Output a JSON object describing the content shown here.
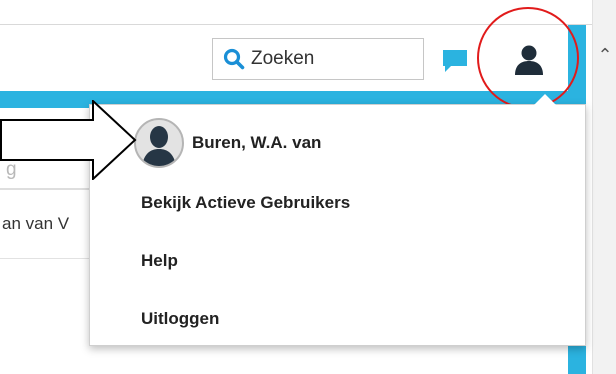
{
  "header": {
    "search_label": "Zoeken"
  },
  "icons": {
    "search": "search-icon",
    "chat": "chat-icon",
    "user": "user-icon",
    "scroll_up": "chevron-up-icon"
  },
  "background": {
    "input_fragment": "g",
    "text_fragment": "an van V"
  },
  "user_menu": {
    "profile_name": "Buren, W.A. van",
    "items": [
      {
        "label": "Bekijk Actieve Gebruikers"
      },
      {
        "label": "Help"
      },
      {
        "label": "Uitloggen"
      }
    ]
  },
  "colors": {
    "accent": "#2bb3e0",
    "search_icon": "#1a8fd6",
    "user_icon": "#1f2d3a",
    "annotation_circle": "#e11b1b"
  }
}
